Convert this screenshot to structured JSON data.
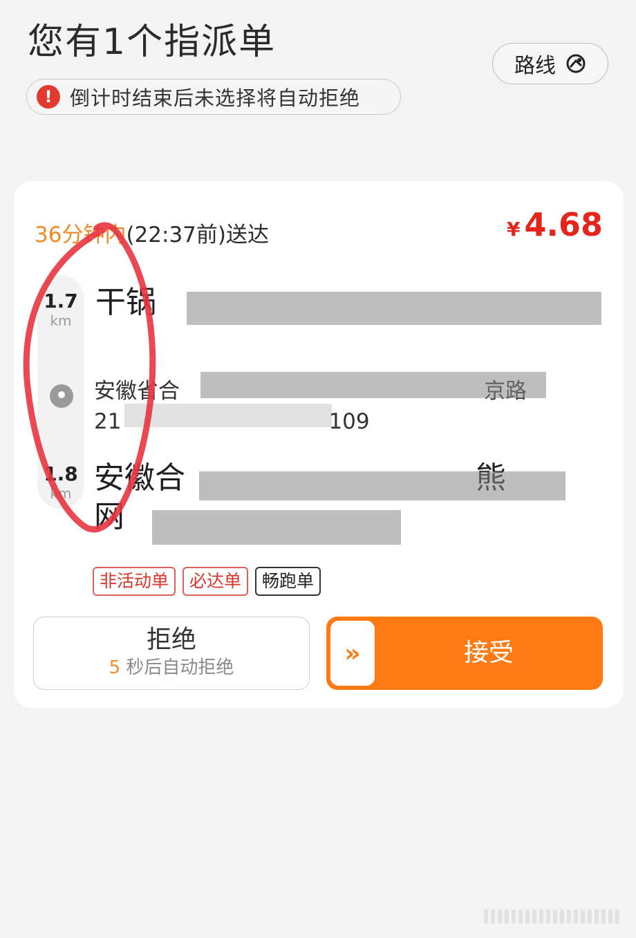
{
  "header": {
    "title": "您有1个指派单",
    "route_label": "路线",
    "notice": "倒计时结束后未选择将自动拒绝"
  },
  "order": {
    "eta_orange": "36分钟内",
    "eta_rest": "(22:37前)送达",
    "price_symbol": "¥",
    "price": "4.68",
    "pickup": {
      "distance": "1.7",
      "unit": "km",
      "name": "干锅",
      "address_line1": "安徽省合",
      "address_line1_end": "京路",
      "address_line2": "21",
      "address_line2_end": "109"
    },
    "dropoff": {
      "distance": "1.8",
      "unit": "km",
      "address_line1": "安徽合",
      "address_line1_end": "熊",
      "address_line2": "网"
    },
    "tags": [
      "非活动单",
      "必达单",
      "畅跑单"
    ],
    "reject": {
      "label": "拒绝",
      "countdown_num": "5",
      "countdown_text": " 秒后自动拒绝"
    },
    "accept": {
      "label": "接受",
      "knob": "»"
    }
  },
  "colors": {
    "accent": "#ff7a12",
    "price": "#e3251b",
    "eta": "#f08a24",
    "annotation": "#e8343f"
  }
}
